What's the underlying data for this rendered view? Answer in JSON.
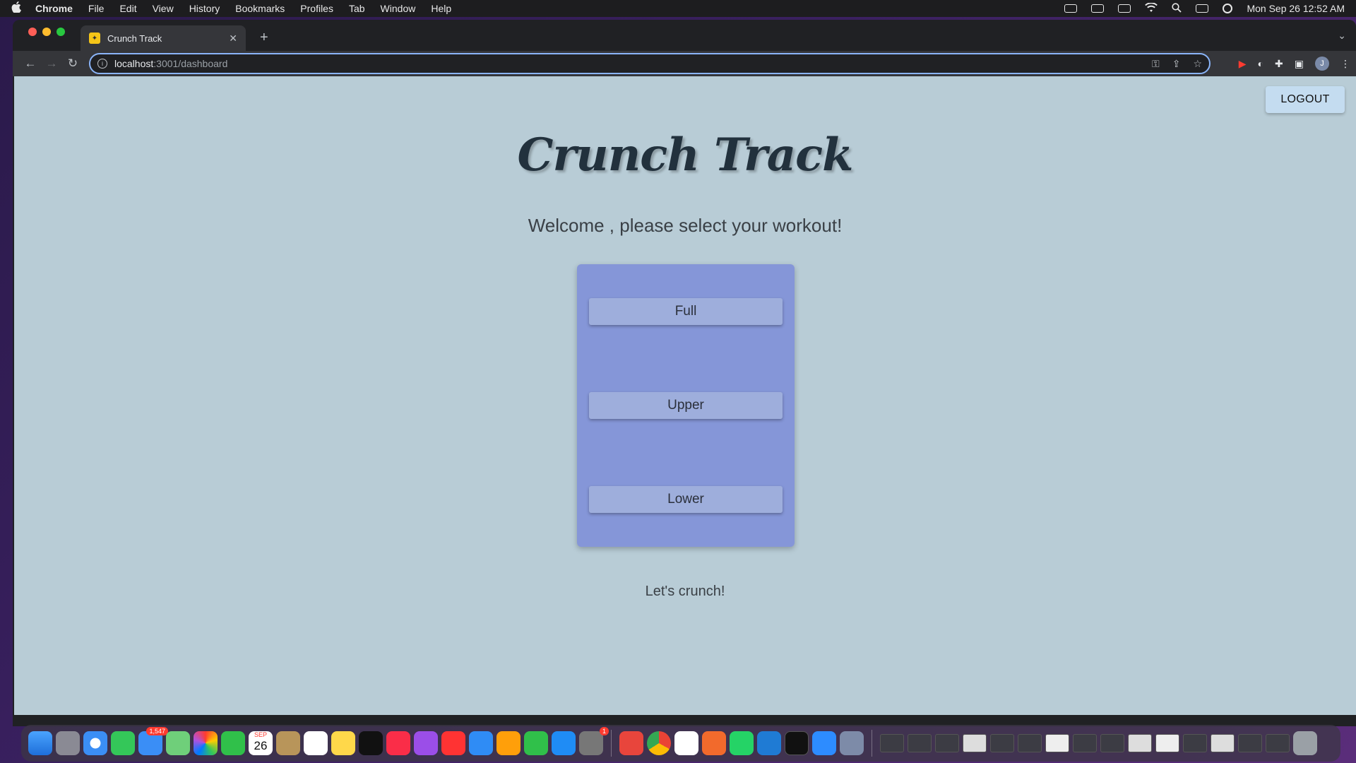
{
  "menubar": {
    "app_name": "Chrome",
    "items": [
      "File",
      "Edit",
      "View",
      "History",
      "Bookmarks",
      "Profiles",
      "Tab",
      "Window",
      "Help"
    ],
    "clock": "Mon Sep 26  12:52 AM"
  },
  "browser": {
    "tab_title": "Crunch Track",
    "url_host": "localhost",
    "url_path": ":3001/dashboard",
    "profile_initial": "J"
  },
  "page": {
    "logout_label": "LOGOUT",
    "brand_title": "Crunch Track",
    "welcome_text": "Welcome , please select your workout!",
    "workouts": [
      "Full",
      "Upper",
      "Lower"
    ],
    "tagline": "Let's crunch!"
  },
  "dock": {
    "mail_badge": "1,547",
    "settings_badge": "1",
    "calendar_month": "SEP",
    "calendar_day": "26"
  }
}
